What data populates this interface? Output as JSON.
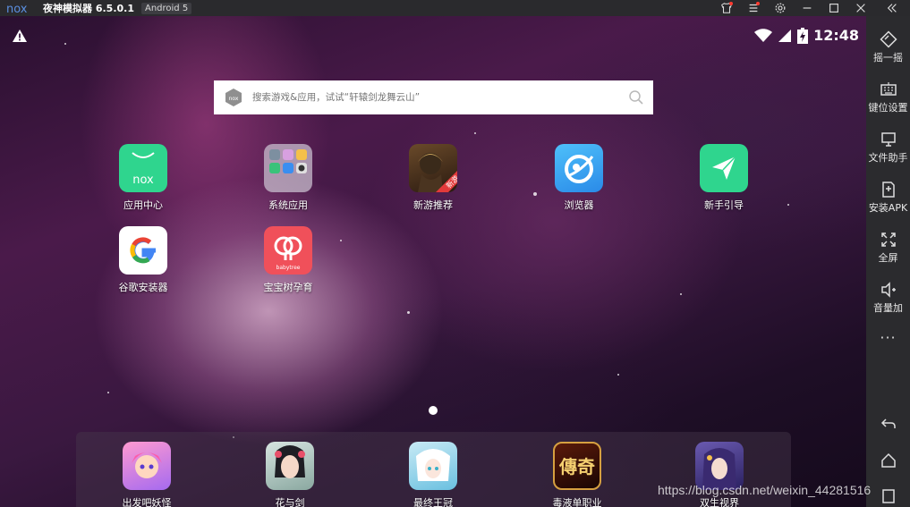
{
  "titlebar": {
    "logo_text": "nox",
    "title": "夜神模拟器 6.5.0.1",
    "android_badge": "Android 5"
  },
  "status": {
    "time": "12:48"
  },
  "search": {
    "placeholder": "搜索游戏&应用，试试“轩辕剑龙舞云山”"
  },
  "apps": [
    {
      "label": "应用中心",
      "icon": "nox-app-center-icon"
    },
    {
      "label": "系统应用",
      "icon": "system-apps-folder-icon"
    },
    {
      "label": "新游推荐",
      "icon": "new-games-icon",
      "badge": "新游"
    },
    {
      "label": "浏览器",
      "icon": "browser-icon"
    },
    {
      "label": "新手引导",
      "icon": "guide-icon"
    },
    {
      "label": "谷歌安装器",
      "icon": "google-installer-icon"
    },
    {
      "label": "宝宝树孕育",
      "icon": "babytree-icon",
      "badge": "babytree"
    }
  ],
  "dock": [
    {
      "label": "出发吧妖怪",
      "icon": "game-icon"
    },
    {
      "label": "花与剑",
      "icon": "game-icon"
    },
    {
      "label": "最终王冠",
      "icon": "game-icon"
    },
    {
      "label": "毒液单职业",
      "icon": "game-icon",
      "glyph": "傳奇"
    },
    {
      "label": "双生视界",
      "icon": "game-icon"
    }
  ],
  "sidebar": {
    "items": [
      {
        "label": "摇一摇",
        "icon": "shake-icon"
      },
      {
        "label": "键位设置",
        "icon": "keyboard-icon"
      },
      {
        "label": "文件助手",
        "icon": "monitor-icon"
      },
      {
        "label": "安装APK",
        "icon": "install-apk-icon"
      },
      {
        "label": "全屏",
        "icon": "fullscreen-icon"
      },
      {
        "label": "音量加",
        "icon": "volume-up-icon"
      }
    ],
    "more": "···"
  },
  "watermark": "https://blog.csdn.net/weixin_44281516",
  "colors": {
    "green": "#2fd58e",
    "blue": "#3aa7f5",
    "titlebar": "#2a2a2d",
    "sidebar": "#2b2b2e"
  }
}
